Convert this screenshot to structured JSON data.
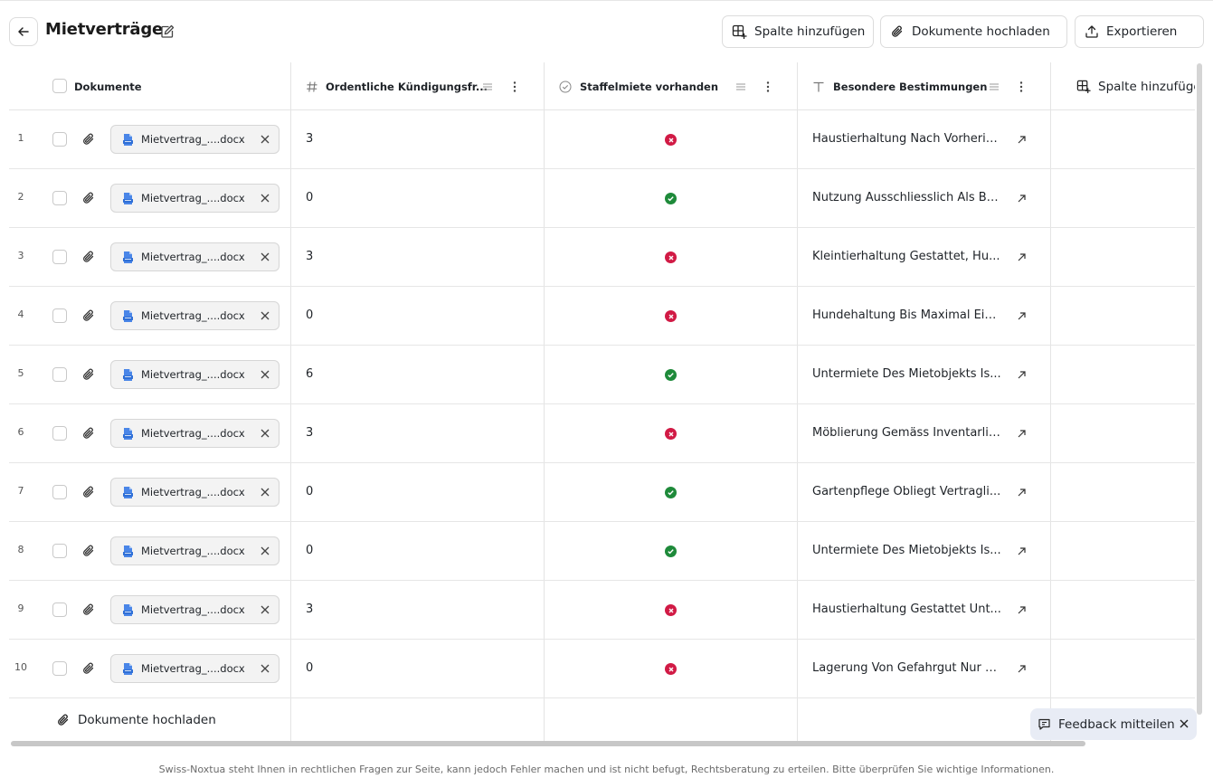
{
  "header": {
    "title": "Mietverträge",
    "buttons": {
      "add_column": "Spalte hinzufügen",
      "upload_documents": "Dokumente hochladen",
      "export": "Exportieren"
    }
  },
  "table": {
    "columns": {
      "documents": "Dokumente",
      "notice_period": "Ordentliche Kündigungsfr...",
      "staggered_rent": "Staffelmiete vorhanden",
      "special_provisions": "Besondere Bestimmungen",
      "add_column": "Spalte hinzufüge"
    },
    "rows": [
      {
        "n": "1",
        "file": "Mietvertrag_....docx",
        "notice": "3",
        "staggered": false,
        "provision": "Haustierhaltung Nach Vorherig..."
      },
      {
        "n": "2",
        "file": "Mietvertrag_....docx",
        "notice": "0",
        "staggered": true,
        "provision": "Nutzung Ausschliesslich Als Bü..."
      },
      {
        "n": "3",
        "file": "Mietvertrag_....docx",
        "notice": "3",
        "staggered": false,
        "provision": "Kleintierhaltung Gestattet, Hu..."
      },
      {
        "n": "4",
        "file": "Mietvertrag_....docx",
        "notice": "0",
        "staggered": false,
        "provision": "Hundehaltung Bis Maximal Ein ..."
      },
      {
        "n": "5",
        "file": "Mietvertrag_....docx",
        "notice": "6",
        "staggered": true,
        "provision": "Untermiete Des Mietobjekts Is..."
      },
      {
        "n": "6",
        "file": "Mietvertrag_....docx",
        "notice": "3",
        "staggered": false,
        "provision": "Möblierung Gemäss Inventarlis..."
      },
      {
        "n": "7",
        "file": "Mietvertrag_....docx",
        "notice": "0",
        "staggered": true,
        "provision": "Gartenpflege Obliegt Vertragli..."
      },
      {
        "n": "8",
        "file": "Mietvertrag_....docx",
        "notice": "0",
        "staggered": true,
        "provision": "Untermiete Des Mietobjekts Is..."
      },
      {
        "n": "9",
        "file": "Mietvertrag_....docx",
        "notice": "3",
        "staggered": false,
        "provision": "Haustierhaltung Gestattet Unt..."
      },
      {
        "n": "10",
        "file": "Mietvertrag_....docx",
        "notice": "0",
        "staggered": false,
        "provision": "Lagerung Von Gefahrgut Nur M..."
      }
    ],
    "upload_link": "Dokumente hochladen"
  },
  "feedback": {
    "label": "Feedback mitteilen"
  },
  "disclaimer": "Swiss-Noxtua steht Ihnen in rechtlichen Fragen zur Seite, kann jedoch Fehler machen und ist nicht befugt, Rechtsberatung zu erteilen. Bitte überprüfen Sie wichtige Informationen.",
  "colors": {
    "status_yes": "#1e8a3a",
    "status_no": "#d11a45",
    "feedback_bg": "#e8ecf5"
  },
  "icons": [
    "arrow-left-icon",
    "edit-icon",
    "table-add-icon",
    "paperclip-icon",
    "upload-icon",
    "hash-icon",
    "check-circle-icon",
    "text-type-icon",
    "menu-lines-icon",
    "kebab-icon",
    "docx-file-icon",
    "close-icon",
    "open-external-icon",
    "feedback-icon"
  ]
}
